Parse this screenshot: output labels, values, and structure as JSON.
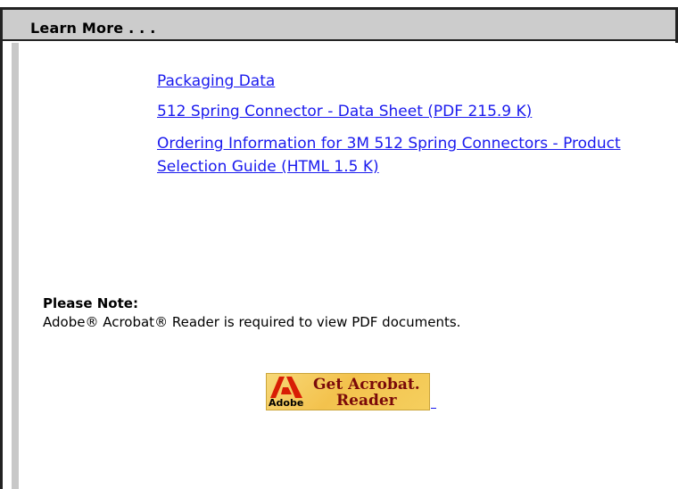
{
  "header": {
    "title": "Learn More . . ."
  },
  "links": [
    {
      "label": "Packaging Data"
    },
    {
      "label": "512 Spring Connector - Data Sheet (PDF 215.9 K)"
    },
    {
      "label": "Ordering Information for 3M 512 Spring Connectors - Product Selection Guide (HTML 1.5 K)"
    }
  ],
  "note": {
    "title": "Please Note:",
    "text": "Adobe® Acrobat® Reader is required to view PDF documents."
  },
  "acrobat_badge": {
    "line1": "Get Acrobat.",
    "line2": "Reader",
    "brand": "Adobe",
    "colors": {
      "background": "#f3c24d",
      "text": "#7a0a0a",
      "logo_red": "#d81e05"
    }
  },
  "colors": {
    "link": "#1a1aee",
    "header_bg": "#cccccc"
  }
}
